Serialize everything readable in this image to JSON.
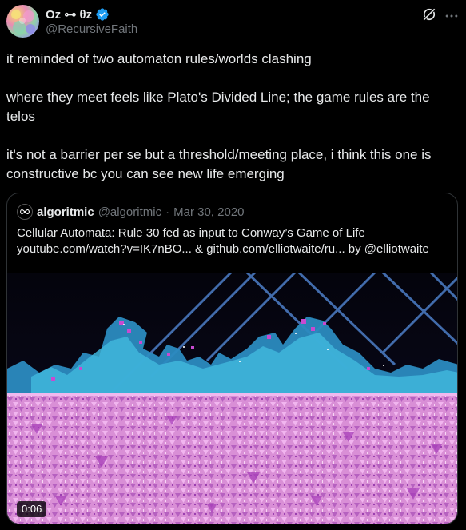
{
  "author": {
    "display_name": "Oz ⊶ θz",
    "handle": "@RecursiveFaith",
    "verified": true
  },
  "tweet": {
    "paragraphs": [
      "it reminded of two automaton rules/worlds clashing",
      "where they meet feels like Plato's Divided Line; the game rules are the telos",
      "it's not a barrier per se but a threshold/meeting place, i think this one is constructive bc you can see new life emerging"
    ]
  },
  "quote": {
    "display_name": "algoritmic",
    "handle": "@algoritmic",
    "separator": "·",
    "date": "Mar 30, 2020",
    "line1": "Cellular Automata: Rule 30 fed as input to Conway’s Game of Life",
    "line2": "youtube.com/watch?v=IK7nBO... & github.com/elliotwaite/ru... by @elliotwaite",
    "video_time": "0:06"
  },
  "colors": {
    "background": "#000000",
    "text_primary": "#e7e9ea",
    "text_secondary": "#71767b",
    "border": "#2f3336",
    "verified_blue": "#1d9bf0",
    "automaton_pink": "#e39be0",
    "automaton_cyan": "#3aa5d8"
  },
  "icons": {
    "verified": "verified-badge-icon",
    "grok": "grok-icon",
    "more": "more-options-icon",
    "quote_avatar": "infinity-logo-icon"
  }
}
